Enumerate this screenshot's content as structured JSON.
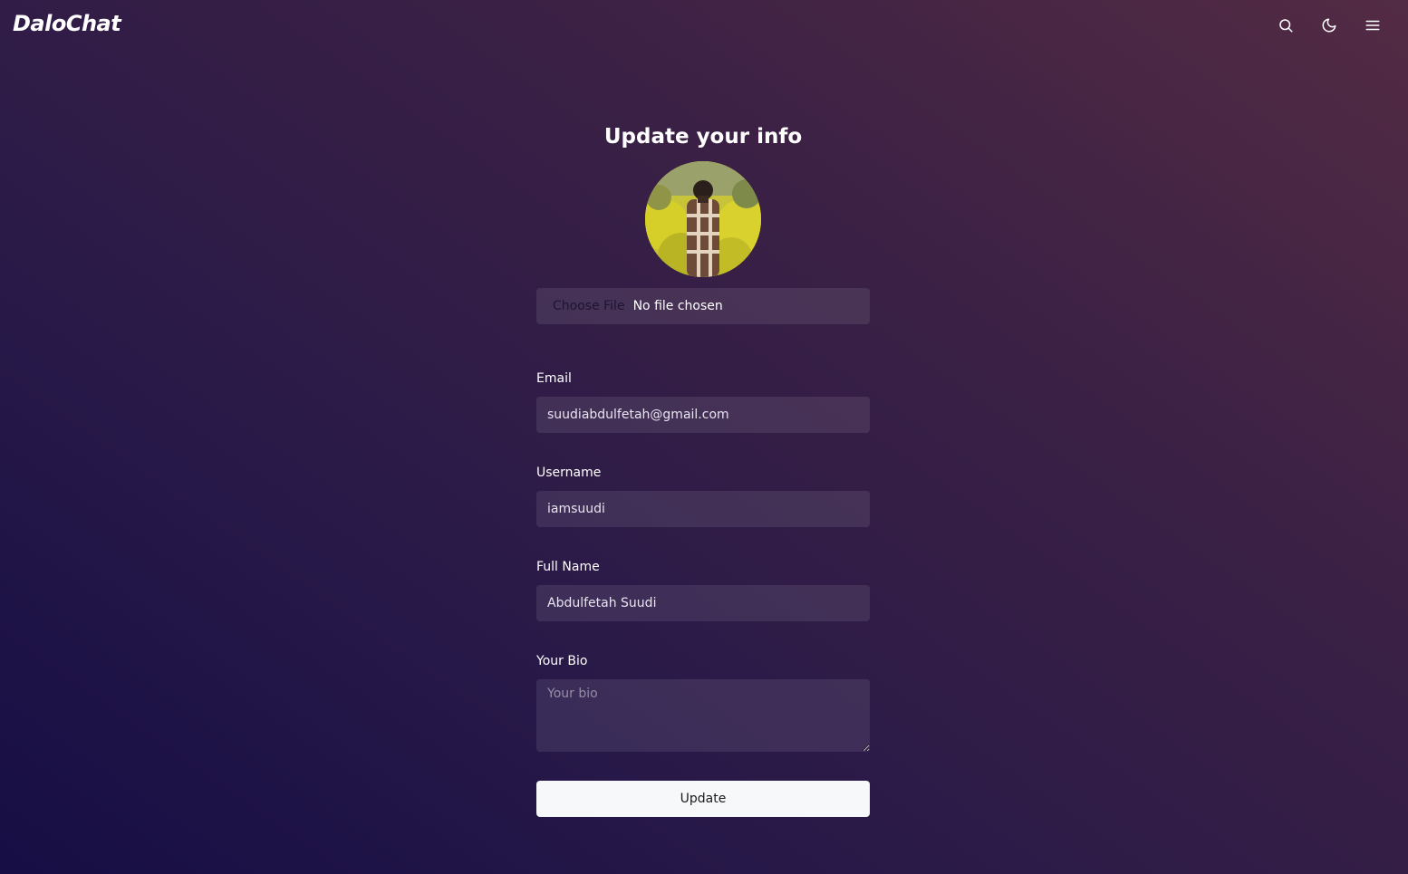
{
  "app": {
    "logo": "DaloChat"
  },
  "header": {
    "icons": [
      "search-icon",
      "moon-icon",
      "menu-icon"
    ]
  },
  "form": {
    "title": "Update your info",
    "file": {
      "button_label": "Choose File",
      "status": "No file chosen"
    },
    "email": {
      "label": "Email",
      "value": "suudiabdulfetah@gmail.com"
    },
    "username": {
      "label": "Username",
      "value": "iamsuudi"
    },
    "full_name": {
      "label": "Full Name",
      "value": "Abdulfetah Suudi"
    },
    "bio": {
      "label": "Your Bio",
      "placeholder": "Your bio",
      "value": ""
    },
    "submit_label": "Update"
  },
  "colors": {
    "background_start": "#160e45",
    "background_end": "#532b44",
    "button_bg": "#f7f8fa"
  }
}
